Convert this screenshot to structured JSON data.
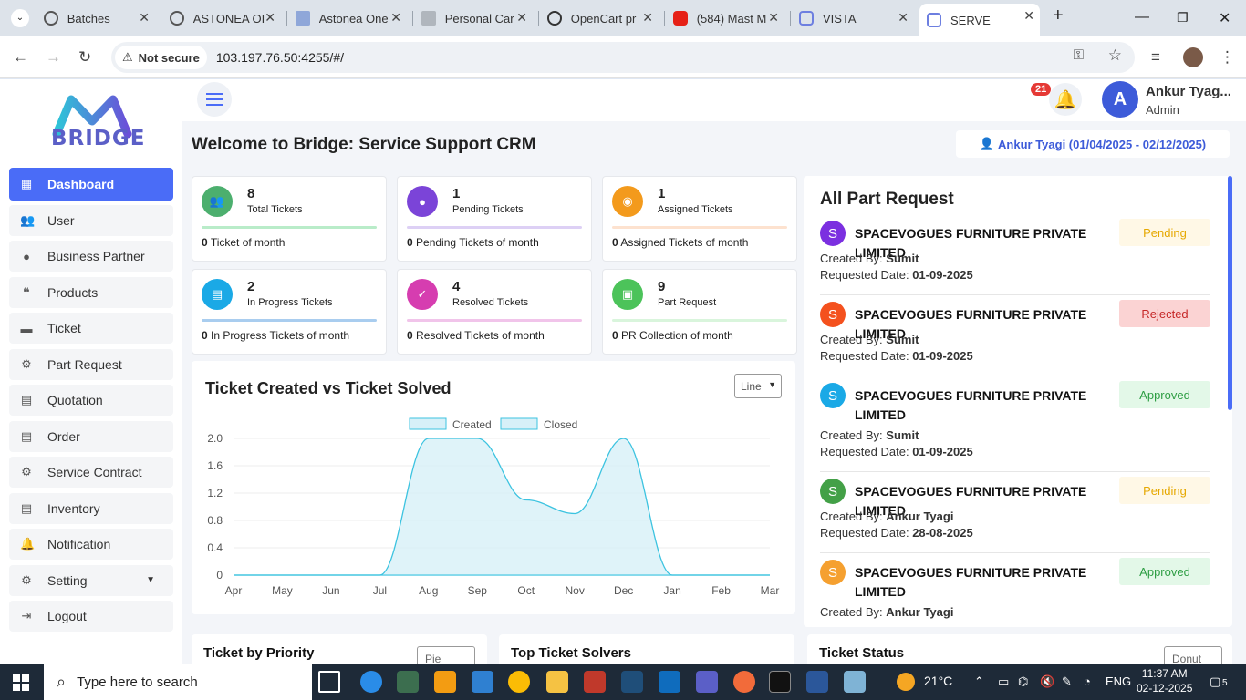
{
  "browser": {
    "tabs": [
      {
        "label": "Batches"
      },
      {
        "label": "ASTONEA OI"
      },
      {
        "label": "Astonea One"
      },
      {
        "label": "Personal Car"
      },
      {
        "label": "OpenCart pr"
      },
      {
        "label": "(584) Mast M"
      },
      {
        "label": "VISTA"
      },
      {
        "label": "SERVE"
      }
    ],
    "security": "Not secure",
    "url": "103.197.76.50:4255/#/"
  },
  "sidebar": {
    "logo_text": "BRIDGE",
    "items": [
      {
        "label": "Dashboard",
        "icon": "grid-icon"
      },
      {
        "label": "User",
        "icon": "users-icon"
      },
      {
        "label": "Business Partner",
        "icon": "person-icon"
      },
      {
        "label": "Products",
        "icon": "quote-icon"
      },
      {
        "label": "Ticket",
        "icon": "ticket-icon"
      },
      {
        "label": "Part Request",
        "icon": "gears-icon"
      },
      {
        "label": "Quotation",
        "icon": "document-icon"
      },
      {
        "label": "Order",
        "icon": "document-icon"
      },
      {
        "label": "Service Contract",
        "icon": "gears-icon"
      },
      {
        "label": "Inventory",
        "icon": "document-icon"
      },
      {
        "label": "Notification",
        "icon": "bell-icon"
      },
      {
        "label": "Setting",
        "icon": "gear-icon"
      },
      {
        "label": "Logout",
        "icon": "logout-icon"
      }
    ]
  },
  "header": {
    "notification_count": "21",
    "avatar_letter": "A",
    "user_name": "Ankur Tyag...",
    "user_role": "Admin"
  },
  "main": {
    "welcome": "Welcome to Bridge: Service Support CRM",
    "date_range": "Ankur Tyagi (01/04/2025 - 02/12/2025)",
    "cards": [
      {
        "value": "8",
        "label": "Total Tickets",
        "month_value": "0",
        "month_label": "Ticket of month",
        "color": "#4caf6e",
        "bar": "#b9ecc9"
      },
      {
        "value": "1",
        "label": "Pending Tickets",
        "month_value": "0",
        "month_label": "Pending Tickets of month",
        "color": "#7b44d8",
        "bar": "#ddd0f5"
      },
      {
        "value": "1",
        "label": "Assigned Tickets",
        "month_value": "0",
        "month_label": "Assigned Tickets of month",
        "color": "#f39a1c",
        "bar": "#fde2cf"
      },
      {
        "value": "2",
        "label": "In Progress Tickets",
        "month_value": "0",
        "month_label": "In Progress Tickets of month",
        "color": "#1aa9e6",
        "bar": "#a9cdef"
      },
      {
        "value": "4",
        "label": "Resolved Tickets",
        "month_value": "0",
        "month_label": "Resolved Tickets of month",
        "color": "#d63db0",
        "bar": "#f1c4ea"
      },
      {
        "value": "9",
        "label": "Part Request",
        "month_value": "0",
        "month_label": "PR Collection of month",
        "color": "#4cc35a",
        "bar": "#d9f5dc"
      }
    ]
  },
  "chart_select": "Line",
  "chart_data": {
    "type": "area",
    "title": "Ticket Created vs Ticket Solved",
    "categories": [
      "Apr",
      "May",
      "Jun",
      "Jul",
      "Aug",
      "Sep",
      "Oct",
      "Nov",
      "Dec",
      "Jan",
      "Feb",
      "Mar"
    ],
    "series": [
      {
        "name": "Created",
        "values": [
          0,
          0,
          0,
          0,
          2,
          2,
          1.1,
          0.9,
          2,
          0,
          0,
          0
        ]
      },
      {
        "name": "Closed",
        "values": [
          0,
          0,
          0,
          0,
          0,
          0,
          0,
          0,
          0,
          0,
          0,
          0
        ]
      }
    ],
    "yticks": [
      "2.0",
      "1.6",
      "1.2",
      "0.8",
      "0.4",
      "0"
    ],
    "ylim": [
      0,
      2
    ],
    "legend": "top-center",
    "color": "#3cc3e0",
    "fill": "#d7f0f8"
  },
  "part_requests": {
    "title": "All Part Request",
    "created_by_label": "Created By:",
    "requested_date_label": "Requested Date:",
    "items": [
      {
        "avatar": "S",
        "color": "#7b2fe0",
        "name": "SPACEVOGUES FURNITURE PRIVATE LIMITED",
        "status": "Pending",
        "created_by": "Sumit",
        "date": "01-09-2025"
      },
      {
        "avatar": "S",
        "color": "#f4511e",
        "name": "SPACEVOGUES FURNITURE PRIVATE LIMITED",
        "status": "Rejected",
        "created_by": "Sumit",
        "date": "01-09-2025"
      },
      {
        "avatar": "S",
        "color": "#1aa9e6",
        "name": "SPACEVOGUES FURNITURE PRIVATE LIMITED",
        "status": "Approved",
        "created_by": "Sumit",
        "date": "01-09-2025"
      },
      {
        "avatar": "S",
        "color": "#43a047",
        "name": "SPACEVOGUES FURNITURE PRIVATE LIMITED",
        "status": "Pending",
        "created_by": "Ankur Tyagi",
        "date": "28-08-2025"
      },
      {
        "avatar": "S",
        "color": "#f5a030",
        "name": "SPACEVOGUES FURNITURE PRIVATE LIMITED",
        "status": "Approved",
        "created_by": "Ankur Tyagi",
        "date": ""
      }
    ]
  },
  "bottom": {
    "priority_title": "Ticket by Priority",
    "priority_select": "Pie",
    "solvers_title": "Top Ticket Solvers",
    "status_title": "Ticket Status",
    "status_select": "Donut"
  },
  "taskbar": {
    "search_placeholder": "Type here to search",
    "temperature": "21°C",
    "language": "ENG",
    "time": "11:37 AM",
    "date": "02-12-2025",
    "notif_count": "5"
  }
}
